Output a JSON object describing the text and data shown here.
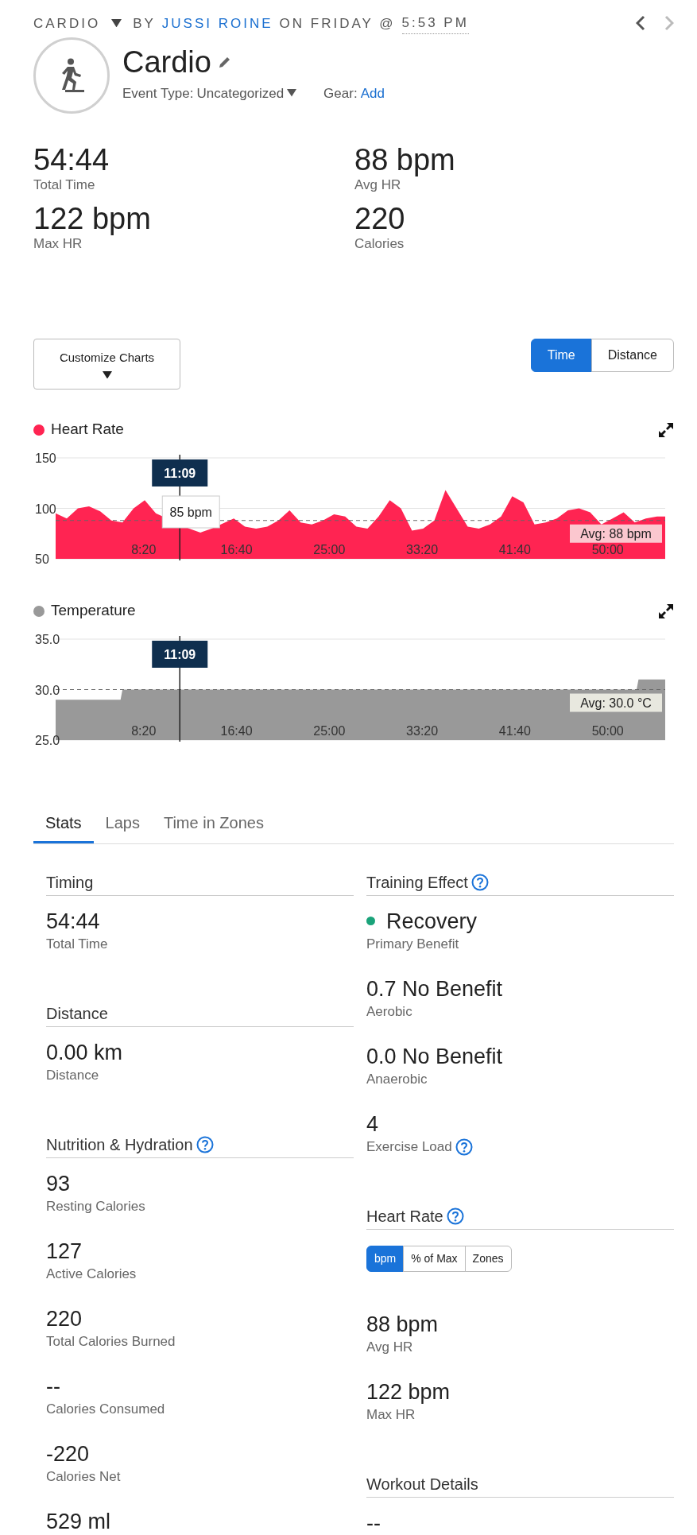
{
  "header": {
    "activity_type": "CARDIO",
    "by": "BY",
    "author": "JUSSI ROINE",
    "on": "ON FRIDAY @",
    "time": "5:53 PM"
  },
  "title": "Cardio",
  "event_type": {
    "label": "Event Type:",
    "value": "Uncategorized"
  },
  "gear": {
    "label": "Gear:",
    "link": "Add"
  },
  "summary": [
    {
      "value": "54:44",
      "label": "Total Time"
    },
    {
      "value": "88 bpm",
      "label": "Avg HR"
    },
    {
      "value": "122 bpm",
      "label": "Max HR"
    },
    {
      "value": "220",
      "label": "Calories"
    }
  ],
  "customize_button": "Customize Charts",
  "axis_toggle": [
    {
      "label": "Time",
      "selected": true
    },
    {
      "label": "Distance",
      "selected": false
    }
  ],
  "charts": [
    {
      "cursor_time": "11:09",
      "tooltip": "85 bpm",
      "chart_data": {
        "type": "area",
        "xlim": [
          0,
          3284
        ],
        "ylim": [
          50,
          150
        ],
        "yticks": [
          150,
          100,
          50
        ],
        "xticks": [
          {
            "value": 500,
            "label": "8:20"
          },
          {
            "value": 1000,
            "label": "16:40"
          },
          {
            "value": 1500,
            "label": "25:00"
          },
          {
            "value": 2000,
            "label": "33:20"
          },
          {
            "value": 2500,
            "label": "41:40"
          },
          {
            "value": 3000,
            "label": "50:00"
          }
        ],
        "x": [
          0,
          60,
          120,
          180,
          240,
          300,
          360,
          420,
          480,
          540,
          600,
          660,
          720,
          780,
          840,
          900,
          960,
          1020,
          1080,
          1140,
          1200,
          1260,
          1320,
          1380,
          1440,
          1500,
          1560,
          1620,
          1680,
          1740,
          1800,
          1860,
          1920,
          1980,
          2040,
          2100,
          2160,
          2220,
          2280,
          2340,
          2400,
          2460,
          2520,
          2580,
          2640,
          2700,
          2760,
          2820,
          2880,
          2940,
          3000,
          3060,
          3120,
          3180,
          3240,
          3284
        ],
        "series": [
          {
            "name": "Heart Rate",
            "color": "#ff2452",
            "values": [
              95,
              90,
              100,
              102,
              97,
              88,
              86,
              100,
              108,
              95,
              null,
              null,
              80,
              76,
              80,
              null,
              90,
              82,
              80,
              82,
              88,
              98,
              86,
              84,
              88,
              94,
              92,
              82,
              80,
              92,
              108,
              100,
              78,
              80,
              88,
              118,
              100,
              82,
              80,
              84,
              92,
              112,
              106,
              84,
              86,
              90,
              98,
              100,
              96,
              84,
              90,
              96,
              86,
              90,
              92,
              92
            ]
          }
        ],
        "ref_lines": [
          {
            "axis": "y",
            "value": 88,
            "label": "Avg: 88 bpm"
          },
          {
            "axis": "x",
            "value": 669
          }
        ]
      }
    },
    {
      "cursor_time": "11:09",
      "chart_data": {
        "type": "area",
        "xlim": [
          0,
          3284
        ],
        "ylim": [
          25,
          35
        ],
        "yticks": [
          {
            "value": 35,
            "label": "35.0"
          },
          {
            "value": 30,
            "label": "30.0"
          },
          {
            "value": 25,
            "label": "25.0"
          }
        ],
        "xticks": [
          {
            "value": 500,
            "label": "8:20"
          },
          {
            "value": 1000,
            "label": "16:40"
          },
          {
            "value": 1500,
            "label": "25:00"
          },
          {
            "value": 2000,
            "label": "33:20"
          },
          {
            "value": 2500,
            "label": "41:40"
          },
          {
            "value": 3000,
            "label": "50:00"
          }
        ],
        "x": [
          0,
          350,
          360,
          3130,
          3140,
          3284
        ],
        "series": [
          {
            "name": "Temperature",
            "color": "#999999",
            "values": [
              29.0,
              29.0,
              30.0,
              30.0,
              31.0,
              31.0
            ]
          }
        ],
        "ref_lines": [
          {
            "axis": "y",
            "value": 30,
            "label": "Avg: 30.0 °C"
          },
          {
            "axis": "x",
            "value": 669
          }
        ]
      }
    }
  ],
  "tabs": [
    {
      "label": "Stats",
      "selected": true
    },
    {
      "label": "Laps",
      "selected": false
    },
    {
      "label": "Time in Zones",
      "selected": false
    }
  ],
  "stats_left": [
    {
      "heading": "Timing",
      "help": false,
      "items": [
        {
          "value": "54:44",
          "label": "Total Time"
        }
      ]
    },
    {
      "heading": "Distance",
      "help": false,
      "items": [
        {
          "value": "0.00 km",
          "label": "Distance"
        }
      ]
    },
    {
      "heading": "Nutrition & Hydration",
      "help": true,
      "items": [
        {
          "value": "93",
          "label": "Resting Calories"
        },
        {
          "value": "127",
          "label": "Active Calories"
        },
        {
          "value": "220",
          "label": "Total Calories Burned"
        },
        {
          "value": "--",
          "label": "Calories Consumed"
        },
        {
          "value": "-220",
          "label": "Calories Net"
        },
        {
          "value": "529 ml"
        }
      ]
    }
  ],
  "stats_right": [
    {
      "heading": "Training Effect",
      "help": true,
      "items": [
        {
          "value": "Recovery",
          "label": "Primary Benefit",
          "color": "#1aa37a"
        },
        {
          "value": "0.7 No Benefit",
          "label": "Aerobic"
        },
        {
          "value": "0.0 No Benefit",
          "label": "Anaerobic"
        },
        {
          "value": "4",
          "label": "Exercise Load",
          "help": true
        }
      ]
    },
    {
      "heading": "Heart Rate",
      "help": true,
      "toggle": [
        {
          "label": "bpm",
          "selected": true
        },
        {
          "label": "% of Max",
          "selected": false
        },
        {
          "label": "Zones",
          "selected": false
        }
      ],
      "items": [
        {
          "value": "88 bpm",
          "label": "Avg HR"
        },
        {
          "value": "122 bpm",
          "label": "Max HR"
        }
      ]
    },
    {
      "heading": "Workout Details",
      "help": false,
      "items": [
        {
          "value": "--"
        }
      ]
    }
  ]
}
